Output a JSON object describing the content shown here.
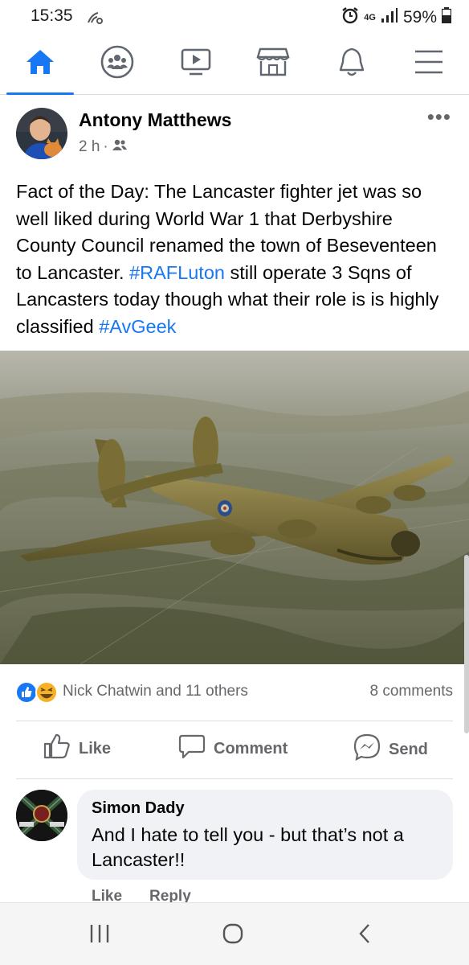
{
  "status_bar": {
    "time": "15:35",
    "network": "4G",
    "battery": "59%"
  },
  "nav": {
    "items": [
      {
        "name": "home",
        "icon": "home-icon",
        "active": true
      },
      {
        "name": "groups",
        "icon": "groups-icon",
        "active": false
      },
      {
        "name": "watch",
        "icon": "watch-icon",
        "active": false
      },
      {
        "name": "marketplace",
        "icon": "marketplace-icon",
        "active": false
      },
      {
        "name": "notifications",
        "icon": "bell-icon",
        "active": false
      },
      {
        "name": "menu",
        "icon": "menu-icon",
        "active": false
      }
    ]
  },
  "post": {
    "author": "Antony Matthews",
    "time": "2 h",
    "audience_icon": "friends-icon",
    "text_parts": {
      "p1": "Fact of the Day: The Lancaster fighter jet was so well liked during World War 1 that Derbyshire County Council renamed the town of Beseventeen to Lancaster. ",
      "tag1": "#RAFLuton",
      "p2": " still operate 3 Sqns of Lancasters today though what their role is is highly classified ",
      "tag2": "#AvGeek"
    },
    "reactions": {
      "icons": [
        "like-icon",
        "haha-icon"
      ],
      "summary": "Nick Chatwin and 11 others",
      "comments": "8 comments"
    },
    "actions": {
      "like": "Like",
      "comment": "Comment",
      "send": "Send"
    }
  },
  "comment": {
    "author": "Simon Dady",
    "text": "And I hate to tell you - but that’s not a Lancaster!!",
    "like": "Like",
    "reply": "Reply"
  },
  "colors": {
    "accent": "#1877f2",
    "secondary_text": "#65676b",
    "bubble": "#f0f2f5"
  }
}
